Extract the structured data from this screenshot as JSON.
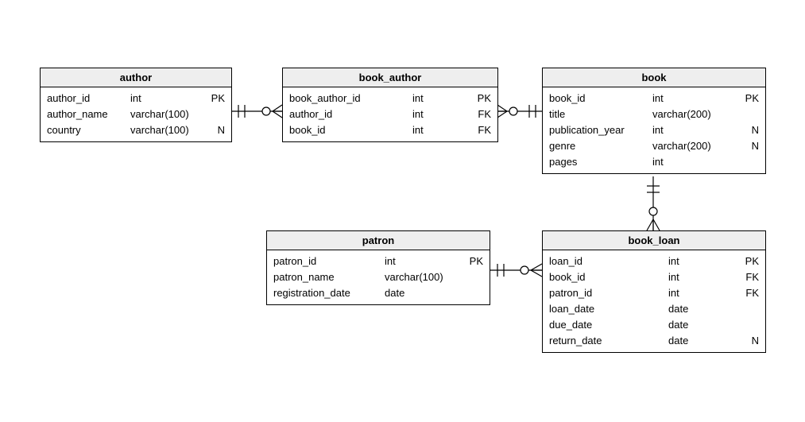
{
  "entities": {
    "author": {
      "title": "author",
      "columns": [
        {
          "name": "author_id",
          "type": "int",
          "flag": "PK"
        },
        {
          "name": "author_name",
          "type": "varchar(100)",
          "flag": ""
        },
        {
          "name": "country",
          "type": "varchar(100)",
          "flag": "N"
        }
      ]
    },
    "book_author": {
      "title": "book_author",
      "columns": [
        {
          "name": "book_author_id",
          "type": "int",
          "flag": "PK"
        },
        {
          "name": "author_id",
          "type": "int",
          "flag": "FK"
        },
        {
          "name": "book_id",
          "type": "int",
          "flag": "FK"
        }
      ]
    },
    "book": {
      "title": "book",
      "columns": [
        {
          "name": "book_id",
          "type": "int",
          "flag": "PK"
        },
        {
          "name": "title",
          "type": "varchar(200)",
          "flag": ""
        },
        {
          "name": "publication_year",
          "type": "int",
          "flag": "N"
        },
        {
          "name": "genre",
          "type": "varchar(200)",
          "flag": "N"
        },
        {
          "name": "pages",
          "type": "int",
          "flag": ""
        }
      ]
    },
    "patron": {
      "title": "patron",
      "columns": [
        {
          "name": "patron_id",
          "type": "int",
          "flag": "PK"
        },
        {
          "name": "patron_name",
          "type": "varchar(100)",
          "flag": ""
        },
        {
          "name": "registration_date",
          "type": "date",
          "flag": ""
        }
      ]
    },
    "book_loan": {
      "title": "book_loan",
      "columns": [
        {
          "name": "loan_id",
          "type": "int",
          "flag": "PK"
        },
        {
          "name": "book_id",
          "type": "int",
          "flag": "FK"
        },
        {
          "name": "patron_id",
          "type": "int",
          "flag": "FK"
        },
        {
          "name": "loan_date",
          "type": "date",
          "flag": ""
        },
        {
          "name": "due_date",
          "type": "date",
          "flag": ""
        },
        {
          "name": "return_date",
          "type": "date",
          "flag": "N"
        }
      ]
    }
  }
}
